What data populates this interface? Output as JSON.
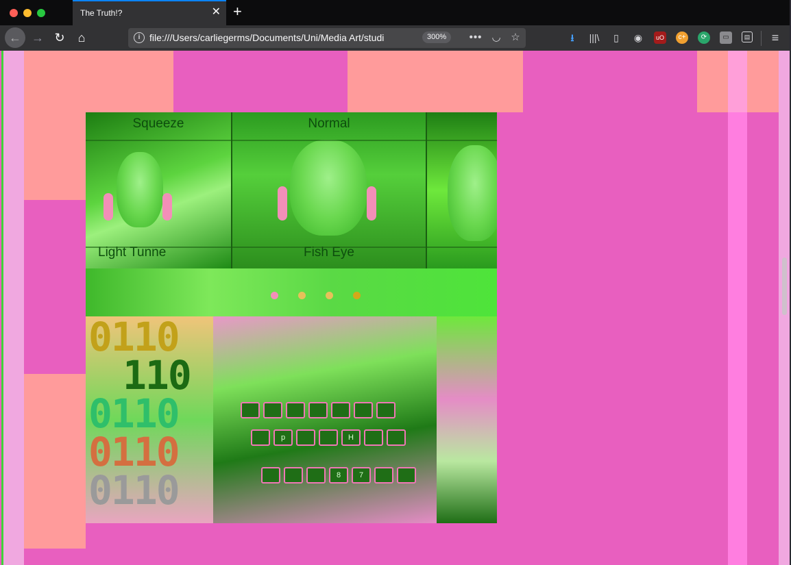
{
  "window": {
    "tab_title": "The Truth!?",
    "close_glyph": "✕",
    "newtab_glyph": "+"
  },
  "toolbar": {
    "back_glyph": "←",
    "forward_glyph": "→",
    "reload_glyph": "↻",
    "home_glyph": "⌂",
    "info_glyph": "i",
    "url": "file:///Users/carliegerms/Documents/Uni/Media Art/studi",
    "zoom": "300%",
    "more_glyph": "•••",
    "pocket_glyph": "◡",
    "bookmark_glyph": "☆",
    "download_glyph": "⭳",
    "library_glyph": "|||\\",
    "sidebar_glyph": "▯",
    "account_glyph": "◉",
    "ext1_glyph": "uO",
    "ext2_glyph": "c+",
    "ext3_glyph": "⟳",
    "ext4_glyph": "▭",
    "ext5_glyph": "▤",
    "menu_glyph": "≡"
  },
  "artwork": {
    "labels": {
      "squeeze": "Squeeze",
      "normal": "Normal",
      "light_tunnel": "Light Tunne",
      "fish_eye": "Fish Eye"
    },
    "binary_lines": [
      "0110",
      "110",
      "0110",
      "0110",
      "0110"
    ],
    "keys_row1": [
      "",
      "",
      "",
      "",
      "",
      "",
      ""
    ],
    "keys_row2": [
      "",
      "p",
      "",
      "",
      "H",
      "",
      ""
    ],
    "keys_row3": [
      "",
      "",
      "",
      "8",
      "7",
      "",
      ""
    ]
  },
  "colors": {
    "page_bg": "#e85fbf",
    "salmon": "#ff9b9b",
    "light_pink": "#f0a8e0",
    "neon_green": "#6ee83c",
    "dark_green": "#1f6e16",
    "accent_blue": "#0a84ff"
  }
}
